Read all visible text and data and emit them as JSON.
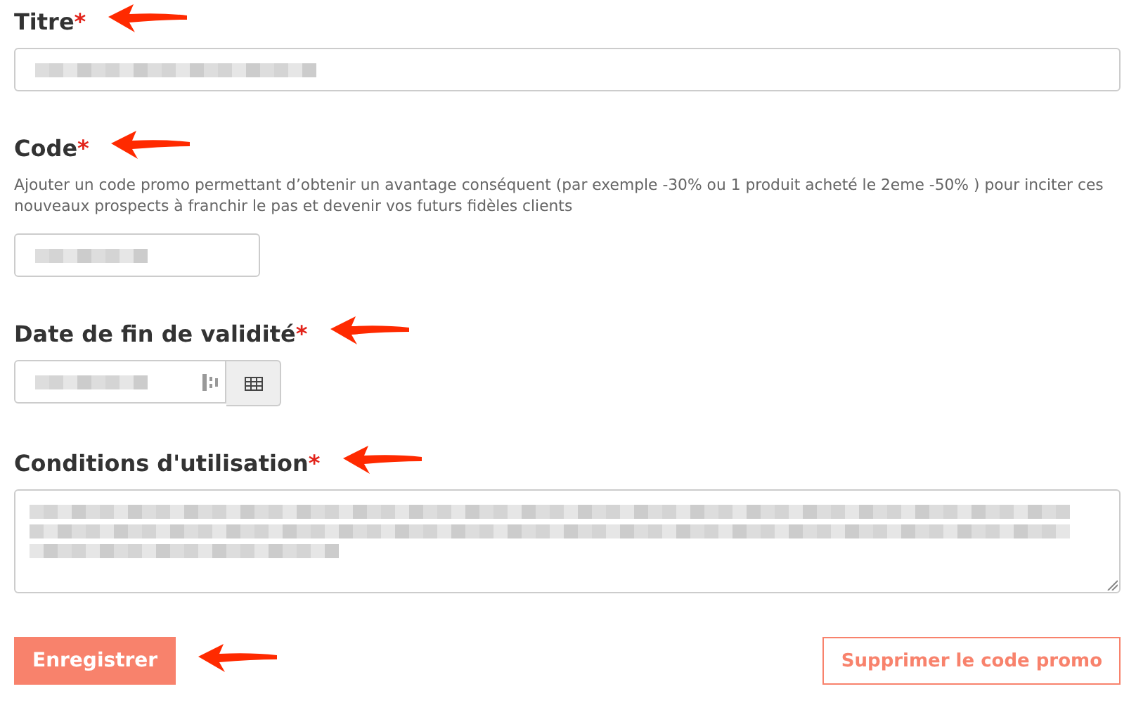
{
  "fields": [
    {
      "kind": "text",
      "label": "Titre",
      "required": "*",
      "annotated": true
    },
    {
      "kind": "short_text",
      "label": "Code",
      "required": "*",
      "annotated": true,
      "help": "Ajouter un code promo permettant d’obtenir un avantage conséquent (par exemple -30% ou 1 produit acheté le 2eme -50% ) pour inciter ces nouveaux prospects à franchir le pas et devenir vos futurs fidèles clients"
    },
    {
      "kind": "date",
      "label": "Date de fin de validité",
      "required": "*",
      "annotated": true
    },
    {
      "kind": "textarea",
      "label": "Conditions d'utilisation",
      "required": "*",
      "annotated": true
    }
  ],
  "buttons": [
    {
      "kind": "primary",
      "label": "Enregistrer",
      "annotated": true
    },
    {
      "kind": "outline",
      "label": "Supprimer le code promo",
      "annotated": false
    }
  ]
}
